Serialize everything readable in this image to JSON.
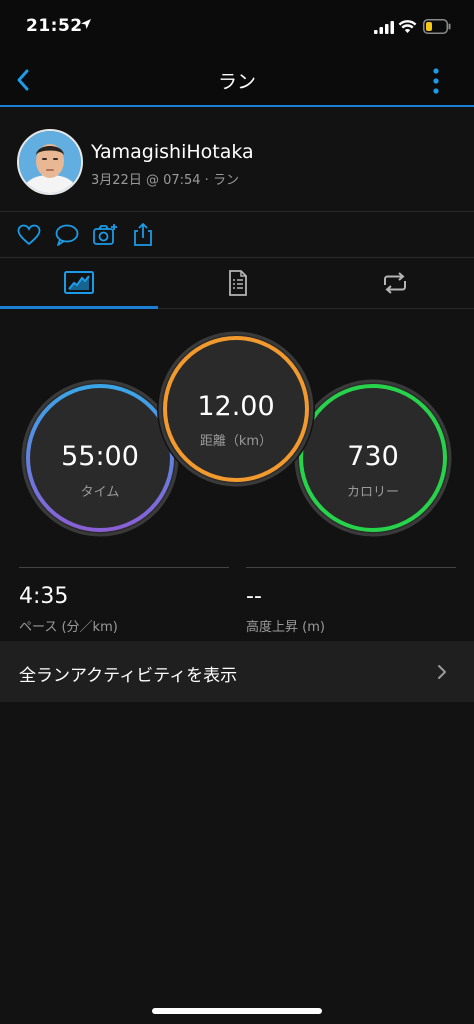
{
  "status_bar": {
    "time": "21:52",
    "location_icon": "location-arrow-icon",
    "signal_icon": "cellular-signal-icon",
    "wifi_icon": "wifi-icon",
    "battery_icon": "battery-low-icon",
    "battery_color": "#f5c518"
  },
  "nav": {
    "back_icon": "chevron-left-icon",
    "title": "ラン",
    "more_icon": "vertical-dots-icon",
    "accent_color": "#1c7fd6"
  },
  "profile": {
    "avatar_icon": "user-avatar",
    "name": "YamagishiHotaka",
    "meta": "3月22日 @ 07:54 · ラン"
  },
  "actions": {
    "like_icon": "heart-icon",
    "comment_icon": "comment-icon",
    "photo_icon": "camera-add-icon",
    "share_icon": "share-icon"
  },
  "tabs": [
    {
      "icon": "chart-summary-icon",
      "active": true
    },
    {
      "icon": "document-list-icon",
      "active": false
    },
    {
      "icon": "laps-repeat-icon",
      "active": false
    }
  ],
  "rings": {
    "time": {
      "value": "55:00",
      "label": "タイム",
      "color_start": "#3aa6e8",
      "color_end": "#8a5fd6"
    },
    "distance": {
      "value": "12.00",
      "label": "距離（km）",
      "color": "#f29a2e"
    },
    "calories": {
      "value": "730",
      "label": "カロリー",
      "color": "#27d34a"
    }
  },
  "stats": [
    {
      "value": "4:35",
      "label": "ペース (分／km)"
    },
    {
      "value": "--",
      "label": "高度上昇 (m)"
    }
  ],
  "all_activities": {
    "label": "全ランアクティビティを表示",
    "chevron_icon": "chevron-right-icon"
  }
}
